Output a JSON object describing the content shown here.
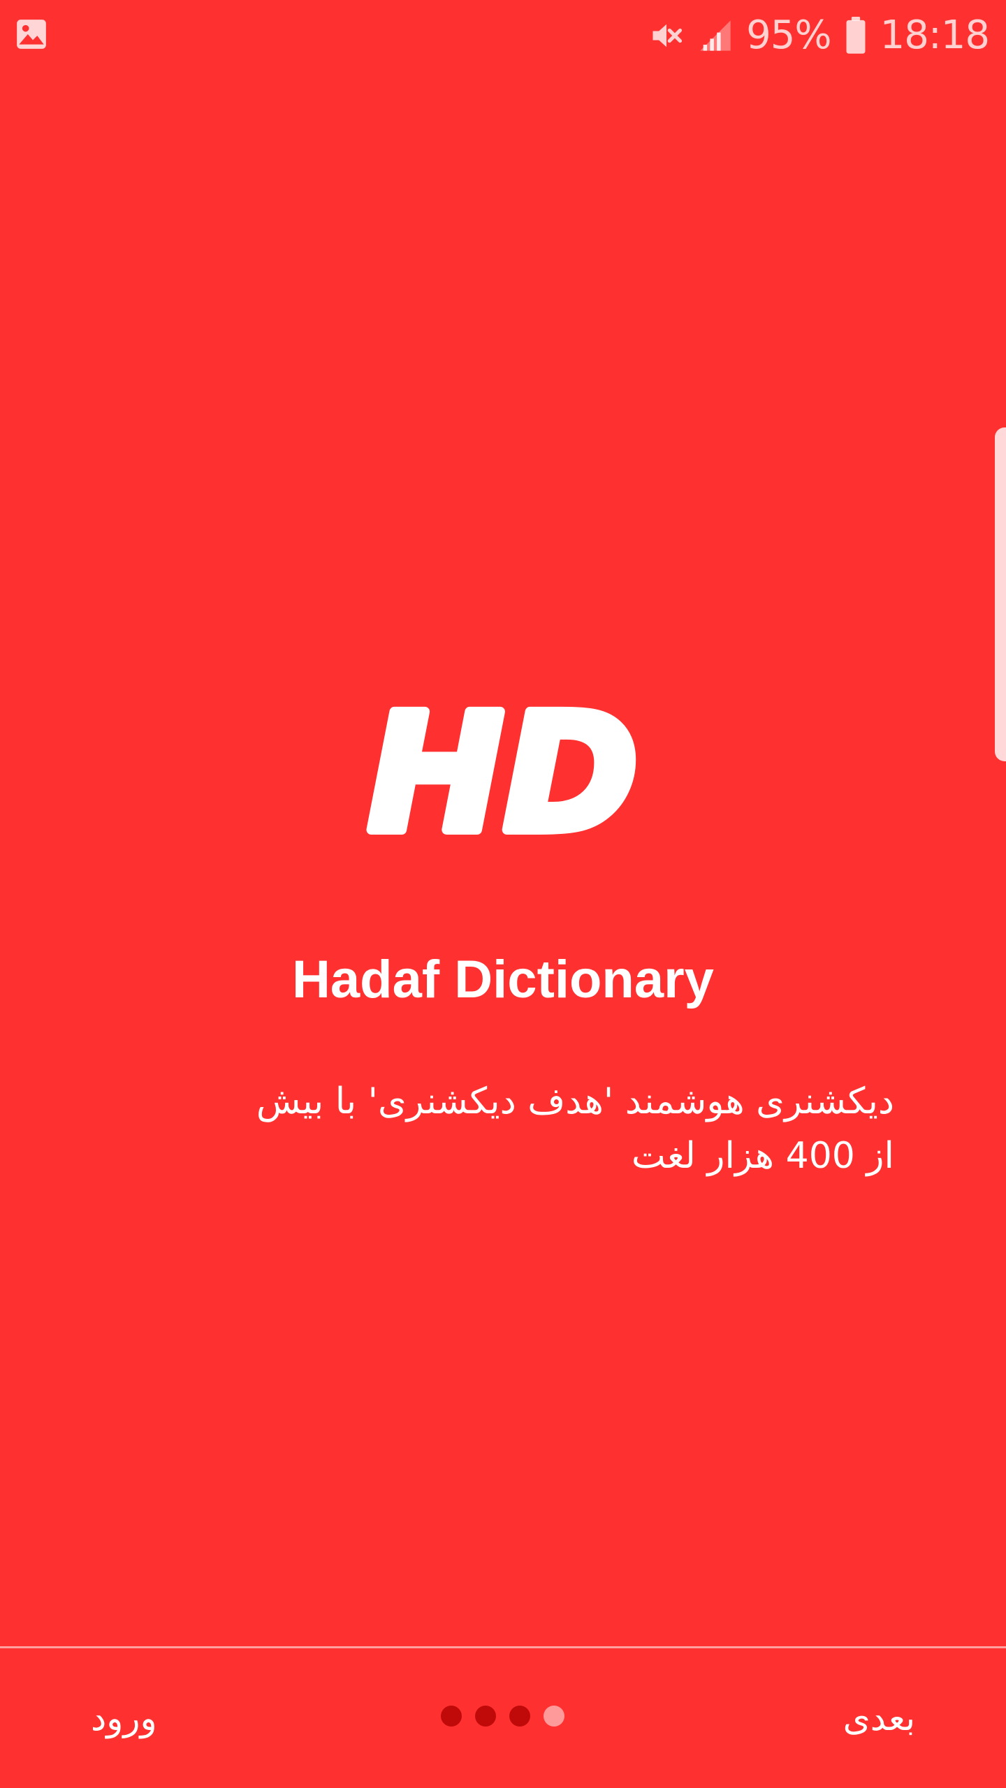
{
  "status_bar": {
    "battery_percent": "95%",
    "time": "18:18",
    "icons": [
      "gallery-notification-icon",
      "mute-icon",
      "signal-icon",
      "battery-icon"
    ]
  },
  "logo": {
    "text": "HD"
  },
  "onboarding": {
    "title": "Hadaf Dictionary",
    "description": "دیکشنری هوشمند 'هدف دیکشنری' با بیش از 400 هزار لغت"
  },
  "pager": {
    "total_pages": 4,
    "active_page": 1
  },
  "footer": {
    "login_label": "ورود",
    "next_label": "بعدی"
  },
  "colors": {
    "background": "#FF3030",
    "foreground": "#FFFFFF",
    "dot_active": "#FF9A9A",
    "dot_inactive": "#C00A0A"
  }
}
